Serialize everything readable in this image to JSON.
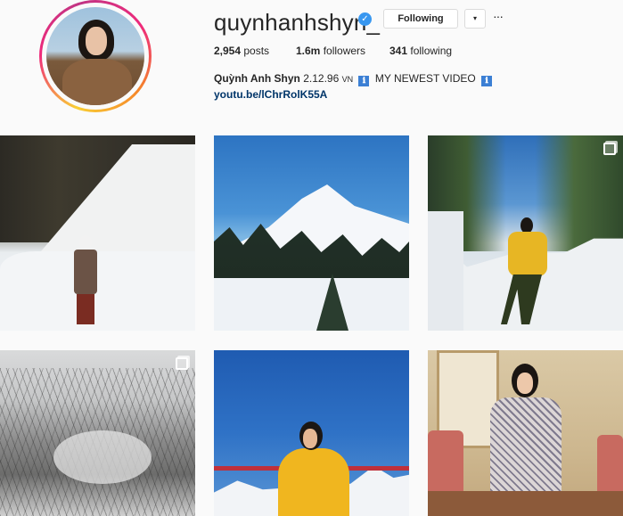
{
  "profile": {
    "username": "quynhanhshyn_",
    "following_button": "Following",
    "caret": "▾",
    "more": "···",
    "stats": {
      "posts_count": "2,954",
      "posts_label": "posts",
      "followers_count": "1.6m",
      "followers_label": "followers",
      "following_count": "341",
      "following_label": "following"
    },
    "bio": {
      "name": "Quỳnh Anh Shyn",
      "date": "2.12.96",
      "country": "VN",
      "info_glyph": "ℹ",
      "video_text": "MY NEWEST VIDEO",
      "link": "youtu.be/lChrRolK55A"
    }
  },
  "colors": {
    "verified": "#3897f0",
    "link": "#003569",
    "ring_start": "#f9ce34",
    "ring_mid": "#ee2a7b",
    "ring_end": "#c13584"
  },
  "icons": {
    "verified": "checkmark-badge-icon",
    "more": "more-options-icon",
    "multi": "multiple-photos-icon"
  },
  "posts": [
    {
      "scene": "snowy thatched house",
      "multi": false
    },
    {
      "scene": "snowy mountain and forest",
      "multi": false
    },
    {
      "scene": "yellow jacket in snow",
      "multi": true
    },
    {
      "scene": "snowy forest valley",
      "multi": true
    },
    {
      "scene": "yellow coat blue sky",
      "multi": false
    },
    {
      "scene": "yukata indoor",
      "multi": false
    }
  ]
}
